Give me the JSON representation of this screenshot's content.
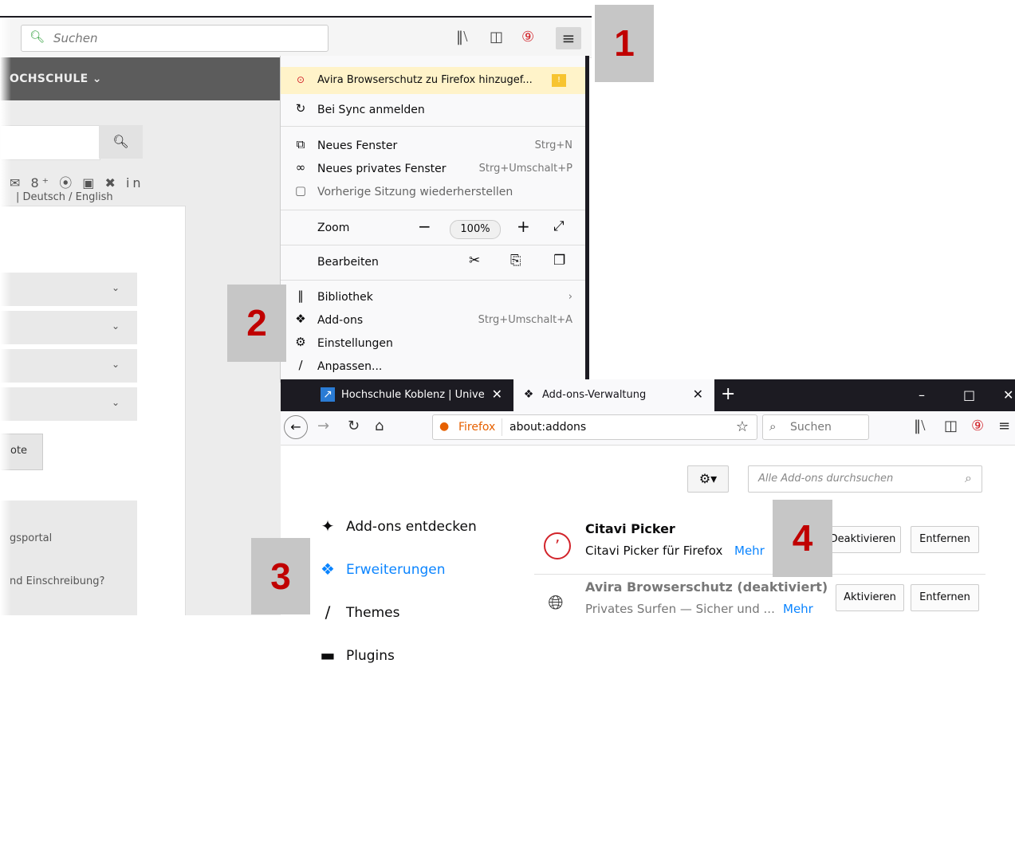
{
  "background_browser": {
    "search_placeholder": "Suchen",
    "nav_label": "OCHSCHULE ⌄",
    "social_icons": "✉ 8⁺ ⦿ ▣ ✖ in",
    "language": "| Deutsch / English",
    "button_label": "ote",
    "link1": "gsportal",
    "link2": "nd Einschreibung?"
  },
  "menu": {
    "avira": "Avira Browserschutz zu Firefox hinzugef...",
    "avira_badge": "!",
    "sync": "Bei Sync anmelden",
    "new_window": "Neues Fenster",
    "new_window_shortcut": "Strg+N",
    "private_window": "Neues privates Fenster",
    "private_window_shortcut": "Strg+Umschalt+P",
    "restore_session": "Vorherige Sitzung wiederherstellen",
    "zoom_label": "Zoom",
    "zoom_value": "100%",
    "edit_label": "Bearbeiten",
    "library": "Bibliothek",
    "addons": "Add-ons",
    "addons_shortcut": "Strg+Umschalt+A",
    "settings": "Einstellungen",
    "customize": "Anpassen..."
  },
  "callouts": [
    "1",
    "2",
    "3",
    "4"
  ],
  "foreground": {
    "tabs": [
      {
        "title": "Hochschule Koblenz | Universit"
      },
      {
        "title": "Add-ons-Verwaltung"
      }
    ],
    "url_label": "Firefox",
    "url": "about:addons",
    "search_placeholder": "Suchen",
    "addon_search_placeholder": "Alle Add-ons durchsuchen",
    "sidebar": [
      {
        "label": "Add-ons entdecken"
      },
      {
        "label": "Erweiterungen"
      },
      {
        "label": "Themes"
      },
      {
        "label": "Plugins"
      }
    ],
    "addons": [
      {
        "name": "Citavi Picker",
        "desc": "Citavi Picker für Firefox",
        "more": "Mehr",
        "btn1": "Deaktivieren",
        "btn2": "Entfernen"
      },
      {
        "name": "Avira Browserschutz  (deaktiviert)",
        "desc": "Privates Surfen — Sicher und ...",
        "more": "Mehr",
        "btn1": "Aktivieren",
        "btn2": "Entfernen"
      }
    ]
  },
  "colors": {
    "accent": "#0a84ff",
    "callout_text": "#c00000",
    "callout_bg": "#c6c6c6",
    "tabbar": "#1c1b22"
  }
}
